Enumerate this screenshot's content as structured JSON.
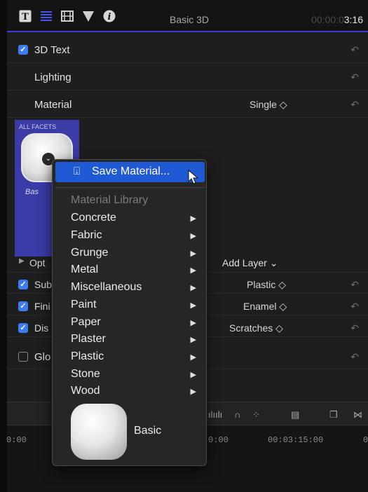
{
  "header": {
    "title": "Basic 3D",
    "timecode_dim": "00:00:0",
    "timecode_bright": "3:16",
    "tabs": [
      {
        "icon": "text-inspector-icon"
      },
      {
        "icon": "lines-inspector-icon"
      },
      {
        "icon": "film-inspector-icon"
      },
      {
        "icon": "color-inspector-icon"
      },
      {
        "icon": "info-inspector-icon"
      }
    ]
  },
  "rows": {
    "text3d_label": "3D Text",
    "lighting_label": "Lighting",
    "material_label": "Material",
    "material_value": "Single ◇"
  },
  "facets": {
    "caption": "ALL FACETS",
    "swatch_label": "Bas"
  },
  "layers": {
    "options_label": "Opt",
    "add_layer": "Add Layer ⌄",
    "items": [
      {
        "label": "Sub",
        "value": "Plastic ◇"
      },
      {
        "label": "Fini",
        "value": "Enamel ◇"
      },
      {
        "label": "Dis",
        "value": "Scratches ◇"
      }
    ],
    "glow_label": "Glo"
  },
  "timeline": {
    "ruler_left": "0:00",
    "ruler_mid": "0:00",
    "ruler_right": "00:03:15:00",
    "ruler_far": "0"
  },
  "menu": {
    "save_label": "Save Material...",
    "library_header": "Material Library",
    "items": [
      {
        "label": "Concrete"
      },
      {
        "label": "Fabric"
      },
      {
        "label": "Grunge"
      },
      {
        "label": "Metal"
      },
      {
        "label": "Miscellaneous"
      },
      {
        "label": "Paint"
      },
      {
        "label": "Paper"
      },
      {
        "label": "Plaster"
      },
      {
        "label": "Plastic"
      },
      {
        "label": "Stone"
      },
      {
        "label": "Wood"
      }
    ],
    "preview_label": "Basic"
  },
  "colors": {
    "accent": "#1f5ad4",
    "checkbox": "#3d7bf0",
    "facet_bg": "#3b3ba7"
  }
}
